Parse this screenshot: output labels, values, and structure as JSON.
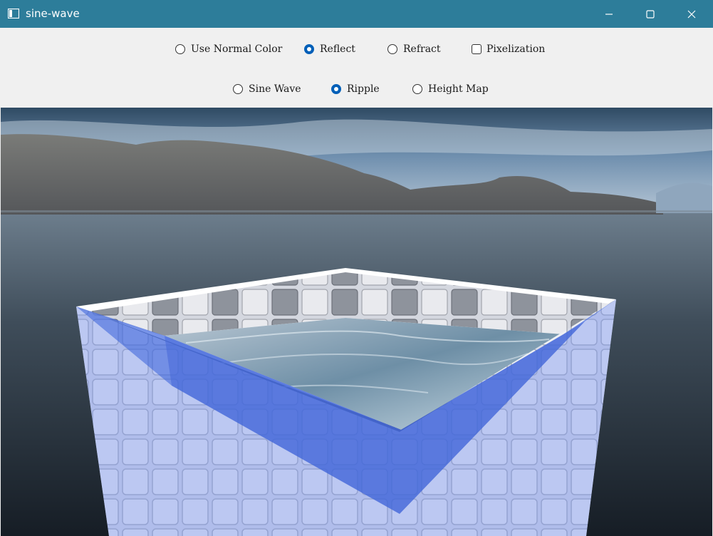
{
  "window": {
    "title": "sine-wave"
  },
  "toolbar": {
    "color_modes": [
      {
        "label": "Use Normal Color",
        "checked": false
      },
      {
        "label": "Reflect",
        "checked": true
      },
      {
        "label": "Refract",
        "checked": false
      }
    ],
    "pixelization": {
      "label": "Pixelization",
      "checked": false
    },
    "wave_modes": [
      {
        "label": "Sine Wave",
        "checked": false
      },
      {
        "label": "Ripple",
        "checked": true
      },
      {
        "label": "Height Map",
        "checked": false
      }
    ]
  },
  "colors": {
    "titlebar": "#2d7d9a",
    "accent": "#005fb8",
    "pool_overlay": "#5a7ee6"
  }
}
